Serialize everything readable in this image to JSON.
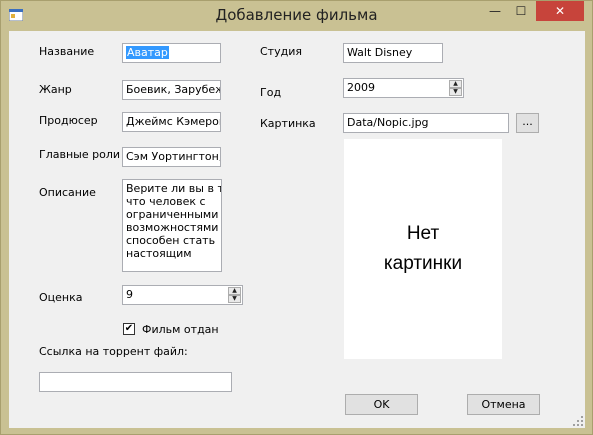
{
  "window": {
    "title": "Добавление фильма",
    "controls": {
      "minimize": "—",
      "maximize": "☐",
      "close": "✕"
    }
  },
  "form": {
    "name": {
      "label": "Название",
      "value": "Аватар"
    },
    "genre": {
      "label": "Жанр",
      "value": "Боевик, Зарубежные"
    },
    "producer": {
      "label": "Продюсер",
      "value": "Джеймс Кэмерон"
    },
    "roles": {
      "label": "Главные роли",
      "value": "Сэм Уортингтон, Зои"
    },
    "description": {
      "label": "Описание",
      "lines": [
        "Верите ли вы в то,",
        "что человек с",
        "ограниченными",
        "возможностями",
        "способен стать",
        "настоящим"
      ]
    },
    "rating": {
      "label": "Оценка",
      "value": "9"
    },
    "given_away": {
      "label": "Фильм отдан",
      "checked": "✔"
    },
    "torrent": {
      "label": "Ссылка на торрент файл:",
      "value": ""
    },
    "studio": {
      "label": "Студия",
      "value": "Walt Disney"
    },
    "year": {
      "label": "Год",
      "value": "2009"
    },
    "picture": {
      "label": "Картинка",
      "value": "Data/Nopic.jpg",
      "browse_label": "...",
      "placeholder_lines": [
        "Нет",
        "картинки"
      ]
    }
  },
  "buttons": {
    "ok": "OK",
    "cancel": "Отмена"
  },
  "colors": {
    "frame": "#c9c193",
    "client": "#f0f0f0",
    "selection": "#3399ff",
    "close_button": "#c7443b"
  }
}
